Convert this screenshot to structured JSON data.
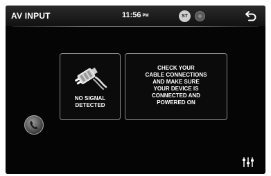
{
  "header": {
    "title": "AV INPUT",
    "time": "11:56",
    "ampm": "PM",
    "st_badge": "ST"
  },
  "message": {
    "status_line1": "NO SIGNAL",
    "status_line2": "DETECTED",
    "instructions": [
      "CHECK YOUR",
      "CABLE CONNECTIONS",
      "AND MAKE SURE",
      "YOUR DEVICE IS",
      "CONNECTED AND",
      "POWERED ON"
    ]
  },
  "icons": {
    "back": "back-arrow-icon",
    "phone": "phone-icon",
    "settings": "equalizer-settings-icon",
    "cable": "unplugged-cable-icon",
    "status": "status-dot-icon"
  }
}
